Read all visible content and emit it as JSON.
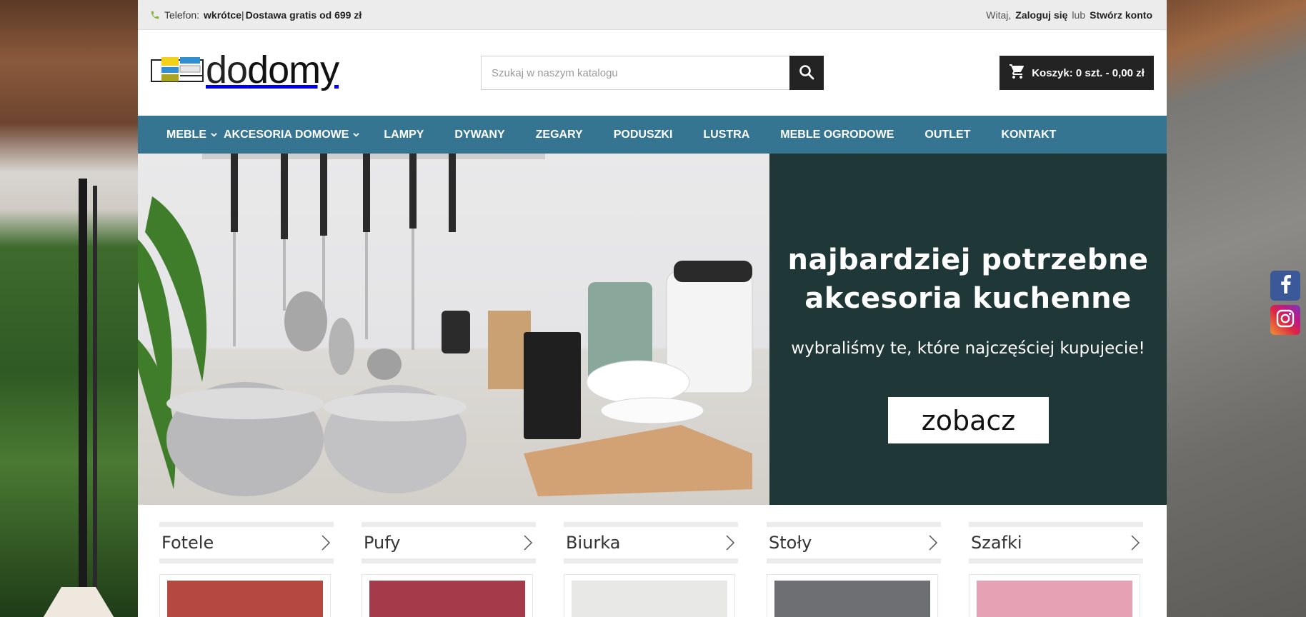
{
  "topbar": {
    "phone_label": "Telefon:",
    "phone_value": "wkrótce",
    "separator": "|",
    "delivery": "Dostawa gratis od 699 zł",
    "greeting": "Witaj,",
    "login": "Zaloguj się",
    "or": "lub",
    "register": "Stwórz konto"
  },
  "header": {
    "logo_text_a": "do",
    "logo_text_b": "domy",
    "search_placeholder": "Szukaj w naszym katalogu",
    "cart_label": "Koszyk: 0 szt. - 0,00 zł"
  },
  "nav": {
    "items": [
      {
        "label": "MEBLE",
        "dropdown": true
      },
      {
        "label": "AKCESORIA DOMOWE",
        "dropdown": true
      },
      {
        "label": "LAMPY",
        "dropdown": false
      },
      {
        "label": "DYWANY",
        "dropdown": false
      },
      {
        "label": "ZEGARY",
        "dropdown": false
      },
      {
        "label": "PODUSZKI",
        "dropdown": false
      },
      {
        "label": "LUSTRA",
        "dropdown": false
      },
      {
        "label": "MEBLE OGRODOWE",
        "dropdown": false
      },
      {
        "label": "OUTLET",
        "dropdown": false
      },
      {
        "label": "KONTAKT",
        "dropdown": false
      }
    ]
  },
  "hero": {
    "title": "najbardziej potrzebne\nakcesoria kuchenne",
    "subtitle": "wybraliśmy te, które najczęściej kupujecie!",
    "cta": "zobacz"
  },
  "categories": [
    {
      "title": "Fotele",
      "image_color": "#b5493f"
    },
    {
      "title": "Pufy",
      "image_color": "#a53a4b"
    },
    {
      "title": "Biurka",
      "image_color": "#e8e8e6"
    },
    {
      "title": "Stoły",
      "image_color": "#6e6f72"
    },
    {
      "title": "Szafki",
      "image_color": "#e7a1b4"
    }
  ],
  "colors": {
    "nav_bg": "#367592",
    "hero_panel_bg": "#1f3736",
    "cart_bg": "#232323"
  },
  "icons": {
    "phone": "phone-icon",
    "search": "search-icon",
    "cart": "cart-icon",
    "chevron": "chevron-down-icon",
    "arrow": "chevron-right-icon",
    "facebook": "facebook-icon",
    "instagram": "instagram-icon"
  }
}
